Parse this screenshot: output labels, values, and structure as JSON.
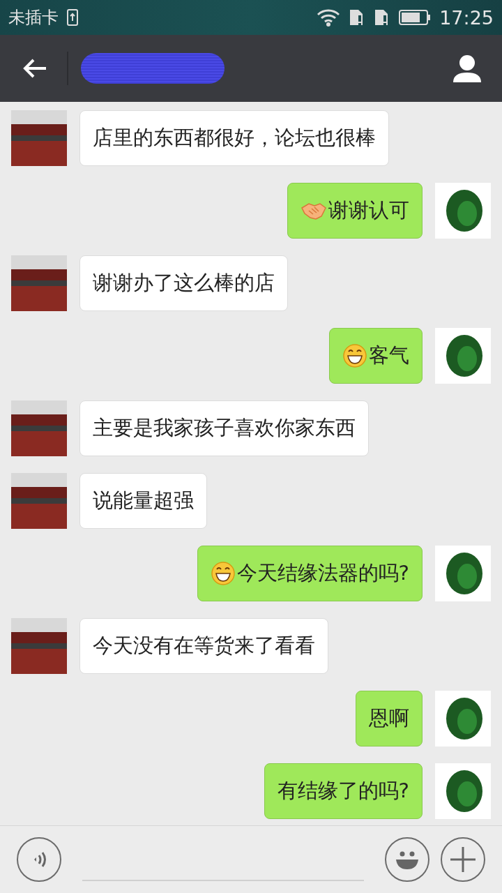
{
  "status_bar": {
    "carrier": "未插卡",
    "time": "17:25"
  },
  "messages": [
    {
      "kind": "incoming",
      "text": "店里的东西都很好，论坛也很棒"
    },
    {
      "kind": "outgoing",
      "emoji": {
        "kind": "handshake"
      },
      "text": "谢谢认可"
    },
    {
      "kind": "incoming",
      "text": "谢谢办了这么棒的店"
    },
    {
      "kind": "outgoing",
      "emoji": {
        "kind": "grin"
      },
      "text": "客气"
    },
    {
      "kind": "incoming",
      "text": "主要是我家孩子喜欢你家东西"
    },
    {
      "kind": "incoming",
      "text": "说能量超强"
    },
    {
      "kind": "outgoing",
      "emoji": {
        "kind": "grin"
      },
      "text": "今天结缘法器的吗?"
    },
    {
      "kind": "incoming",
      "text": "今天没有在等货来了看看"
    },
    {
      "kind": "outgoing",
      "text": "恩啊"
    },
    {
      "kind": "outgoing",
      "text": "有结缘了的吗?"
    }
  ]
}
